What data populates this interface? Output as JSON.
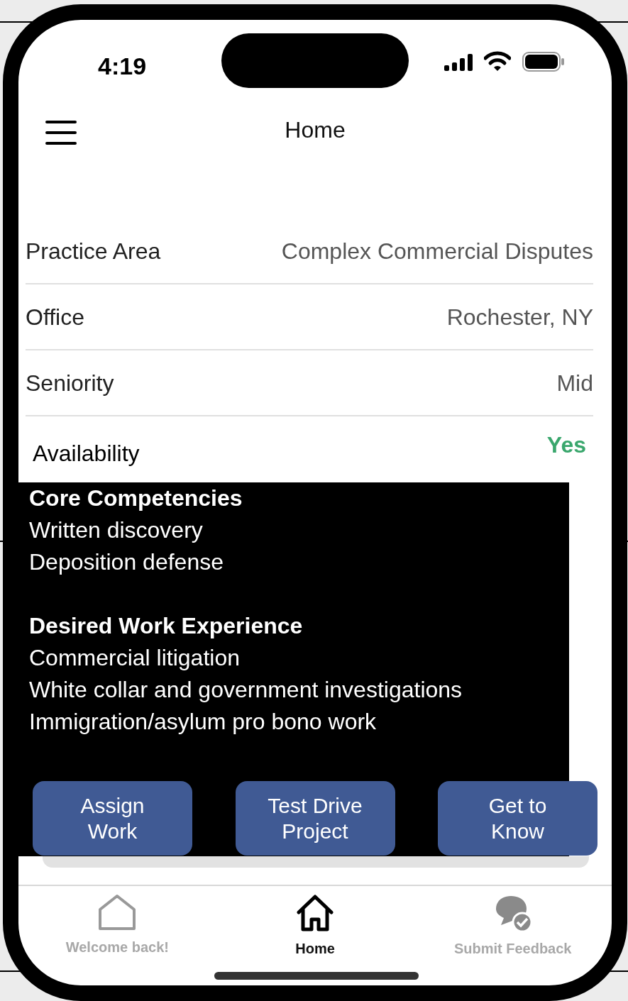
{
  "status_bar": {
    "time": "4:19"
  },
  "header": {
    "title": "Home"
  },
  "details": [
    {
      "kind": "text",
      "label": "Practice Area",
      "value": "Complex Commercial Disputes"
    },
    {
      "kind": "text",
      "label": "Office",
      "value": "Rochester, NY"
    },
    {
      "kind": "text",
      "label": "Seniority",
      "value": "Mid"
    },
    {
      "kind": "status",
      "label": "Availability",
      "value": "Yes"
    }
  ],
  "sections": [
    {
      "title": "Core Competencies",
      "items": [
        "Written discovery",
        "Deposition defense"
      ]
    },
    {
      "title": "Desired Work Experience",
      "items": [
        "Commercial litigation",
        "White collar and government investigations",
        "Immigration/asylum pro bono work"
      ]
    }
  ],
  "actions": [
    "Assign Work",
    "Test Drive Project",
    "Get to Know"
  ],
  "tabs": [
    {
      "kind": "outline-home",
      "label": "Welcome back!",
      "selected": false
    },
    {
      "kind": "home",
      "label": "Home",
      "selected": true
    },
    {
      "kind": "feedback",
      "label": "Submit Feedback",
      "selected": false
    }
  ]
}
